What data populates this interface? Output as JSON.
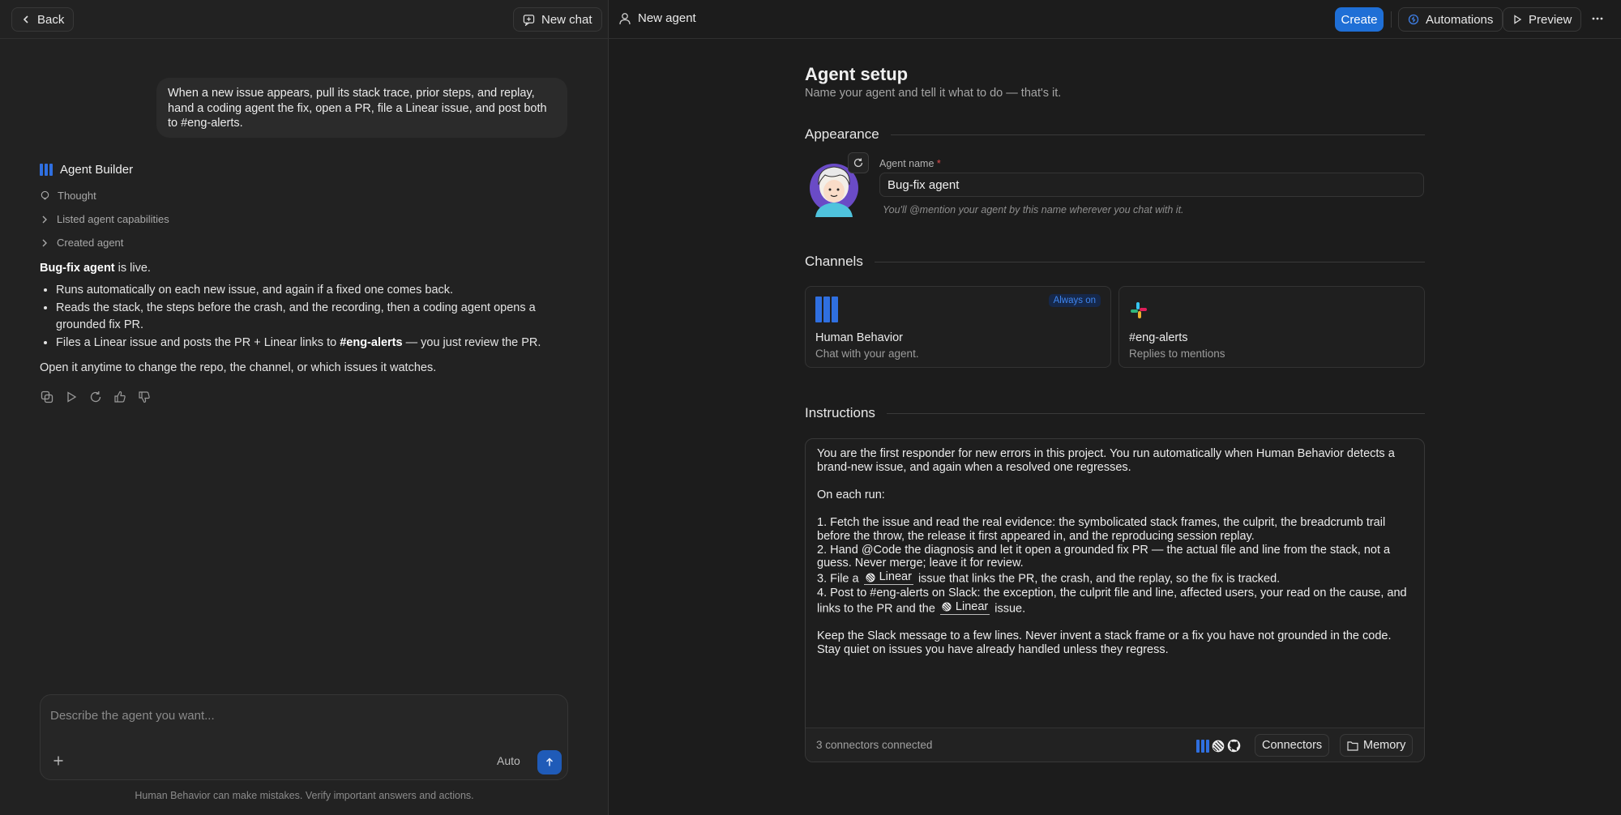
{
  "left": {
    "back_label": "Back",
    "new_chat_label": "New chat",
    "user_message": "When a new issue appears, pull its stack trace, prior steps, and replay, hand a coding agent the fix, open a PR, file a Linear issue, and post both to #eng-alerts.",
    "assistant_name": "Agent Builder",
    "steps": [
      "Thought",
      "Listed agent capabilities",
      "Created agent"
    ],
    "reply": {
      "intro_bold": "Bug-fix agent",
      "intro_rest": " is live.",
      "bullets": [
        "Runs automatically on each new issue, and again if a fixed one comes back.",
        "Reads the stack, the steps before the crash, and the recording, then a coding agent opens a grounded fix PR.",
        "Files a Linear issue and posts the PR + Linear links to "
      ],
      "bullet3_bold": "#eng-alerts",
      "bullet3_rest": " — you just review the PR.",
      "closing": "Open it anytime to change the repo, the channel, or which issues it watches."
    },
    "composer": {
      "placeholder": "Describe the agent you want...",
      "mode": "Auto"
    },
    "disclaimer": "Human Behavior can make mistakes. Verify important answers and actions."
  },
  "header": {
    "title": "New agent",
    "create_label": "Create",
    "automations_label": "Automations",
    "preview_label": "Preview"
  },
  "setup": {
    "title": "Agent setup",
    "subtitle": "Name your agent and tell it what to do — that's it.",
    "appearance_heading": "Appearance",
    "agent_name_label": "Agent name",
    "required_mark": "*",
    "agent_name_value": "Bug-fix agent",
    "agent_name_hint": "You'll @mention your agent by this name wherever you chat with it.",
    "channels_heading": "Channels",
    "channels": [
      {
        "name": "Human Behavior",
        "desc": "Chat with your agent.",
        "badge": "Always on"
      },
      {
        "name": "#eng-alerts",
        "desc": "Replies to mentions"
      }
    ],
    "instructions_heading": "Instructions",
    "instructions": {
      "p1": "You are the first responder for new errors in this project. You run automatically when Human Behavior detects a brand-new issue, and again when a resolved one regresses.",
      "p2": "On each run:",
      "s1": "1. Fetch the issue and read the real evidence: the symbolicated stack frames, the culprit, the breadcrumb trail before the throw, the release it first appeared in, and the reproducing session replay.",
      "s2": "2. Hand @Code the diagnosis and let it open a grounded fix PR — the actual file and line from the stack, not a guess. Never merge; leave it for review.",
      "s3a": "3. File a ",
      "s3b": " issue that links the PR, the crash, and the replay, so the fix is tracked.",
      "s4a": "4. Post to #eng-alerts on Slack: the exception, the culprit file and line, affected users, your read on the cause, and links to the PR and the ",
      "s4b": " issue.",
      "chip_label": "Linear",
      "p3": "Keep the Slack message to a few lines. Never invent a stack frame or a fix you have not grounded in the code. Stay quiet on issues you have already handled unless they regress."
    },
    "footer": {
      "connectors_count": "3 connectors connected",
      "connectors_label": "Connectors",
      "memory_label": "Memory"
    }
  },
  "colors": {
    "accent": "#2f6fe0",
    "create_button": "#1f6fd6",
    "background": "#1c1c1c"
  }
}
